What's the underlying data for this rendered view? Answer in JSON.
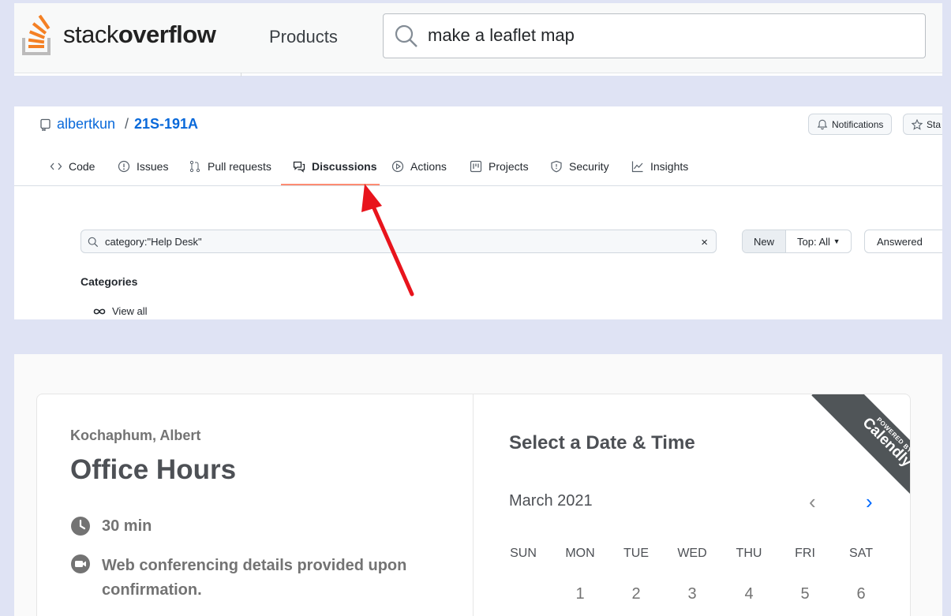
{
  "stackoverflow": {
    "logo_text_regular": "stack",
    "logo_text_bold": "overflow",
    "nav_products": "Products",
    "search_value": "make a leaflet map",
    "logo_icon": "stackoverflow-logo-icon",
    "search_icon": "search-icon"
  },
  "github": {
    "repo_owner": "albertkun",
    "repo_sep": "/",
    "repo_name": "21S-191A",
    "notifications_label": "Notifications",
    "star_label": "Sta",
    "tabs": [
      {
        "label": "Code",
        "icon": "code-icon"
      },
      {
        "label": "Issues",
        "icon": "issue-icon"
      },
      {
        "label": "Pull requests",
        "icon": "pull-request-icon"
      },
      {
        "label": "Discussions",
        "icon": "discussions-icon",
        "active": true
      },
      {
        "label": "Actions",
        "icon": "play-icon"
      },
      {
        "label": "Projects",
        "icon": "project-icon"
      },
      {
        "label": "Security",
        "icon": "shield-icon"
      },
      {
        "label": "Insights",
        "icon": "graph-icon"
      }
    ],
    "filter_value": "category:\"Help Desk\"",
    "clear_symbol": "×",
    "sort_new": "New",
    "sort_top": "Top: All",
    "answered_label": "Answered",
    "categories_heading": "Categories",
    "view_all_label": "View all",
    "accent_underline": "#fd8c73",
    "link_color": "#0969da"
  },
  "annotation": {
    "arrow_color": "#e8141c",
    "arrow_target": "Discussions tab"
  },
  "calendly": {
    "owner": "Kochaphum, Albert",
    "event_title": "Office Hours",
    "duration": "30 min",
    "conferencing": "Web conferencing details provided upon confirmation.",
    "conferencing_line1": "Web conferencing details provided upon",
    "conferencing_line2": "confirmation.",
    "select_heading": "Select a Date & Time",
    "month": "March 2021",
    "prev_symbol": "‹",
    "next_symbol": "›",
    "days_of_week": [
      "SUN",
      "MON",
      "TUE",
      "WED",
      "THU",
      "FRI",
      "SAT"
    ],
    "first_row_dates": [
      "",
      "1",
      "2",
      "3",
      "4",
      "5",
      "6"
    ],
    "ribbon_small": "POWERED BY",
    "ribbon_big": "Calendly",
    "accent": "#0069ff"
  }
}
